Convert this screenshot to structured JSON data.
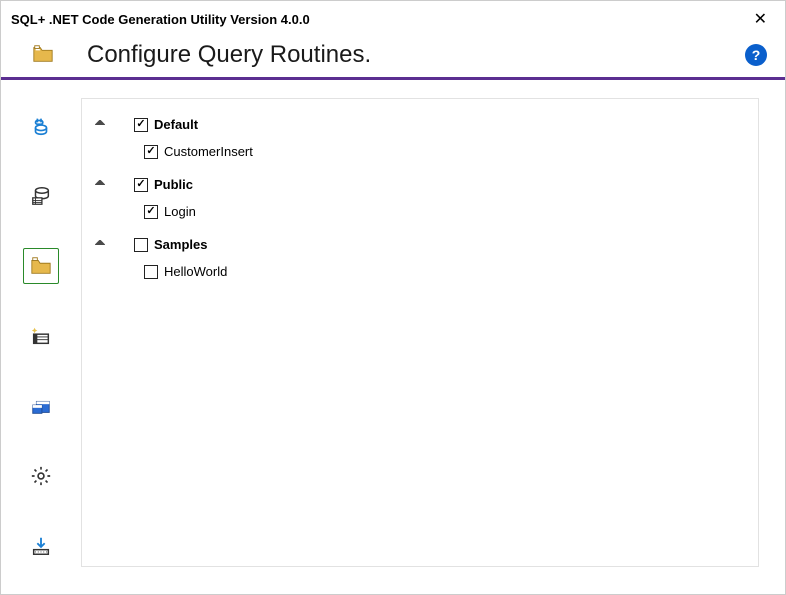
{
  "window": {
    "title": "SQL+ .NET Code Generation Utility Version 4.0.0",
    "close_glyph": "✕"
  },
  "header": {
    "title": "Configure Query Routines.",
    "icon_name": "folder-open-plus",
    "help_glyph": "?"
  },
  "sidebar": {
    "items": [
      {
        "name": "db-connect",
        "active": false
      },
      {
        "name": "db-stored",
        "active": false
      },
      {
        "name": "folder-open",
        "active": true
      },
      {
        "name": "enum-list",
        "active": false
      },
      {
        "name": "tab-config",
        "active": false
      },
      {
        "name": "gear",
        "active": false
      },
      {
        "name": "download",
        "active": false
      }
    ]
  },
  "tree": {
    "groups": [
      {
        "label": "Default",
        "checked": true,
        "expanded": true,
        "children": [
          {
            "label": "CustomerInsert",
            "checked": true
          }
        ]
      },
      {
        "label": "Public",
        "checked": true,
        "expanded": true,
        "children": [
          {
            "label": "Login",
            "checked": true
          }
        ]
      },
      {
        "label": "Samples",
        "checked": false,
        "expanded": true,
        "children": [
          {
            "label": "HelloWorld",
            "checked": false
          }
        ]
      }
    ]
  }
}
